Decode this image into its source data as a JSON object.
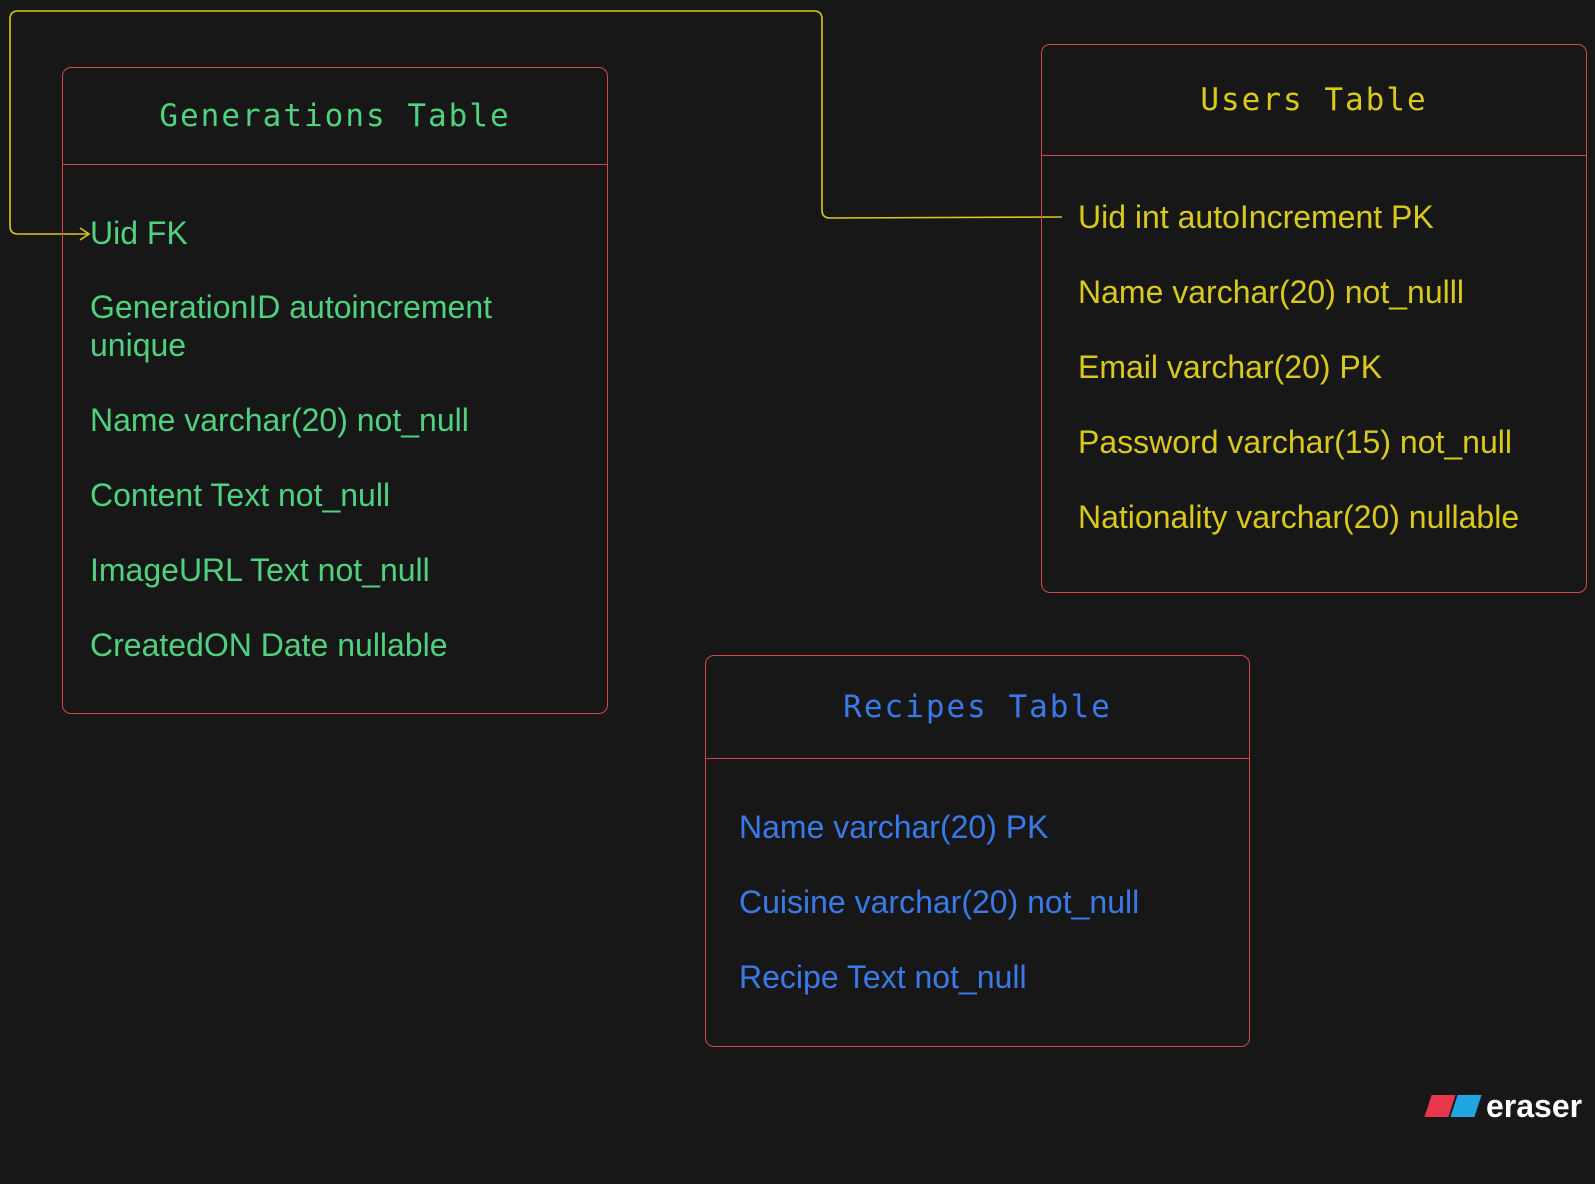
{
  "colors": {
    "background": "#171717",
    "box_border": "#d04848",
    "generations": "#4fd17f",
    "users": "#d8c91c",
    "recipes": "#3a7ae8",
    "connector": "#d8c91c",
    "logo_red": "#e8364a",
    "logo_blue": "#1fa6e0"
  },
  "generations_table": {
    "title": "Generations Table",
    "fields": [
      "Uid FK",
      "GenerationID autoincrement",
      "unique",
      "Name varchar(20) not_null",
      "Content Text not_null",
      "ImageURL Text not_null",
      "CreatedON Date nullable"
    ]
  },
  "users_table": {
    "title": "Users Table",
    "fields": [
      "Uid int autoIncrement PK",
      "Name varchar(20) not_nulll",
      "Email varchar(20) PK",
      "Password varchar(15) not_null",
      "Nationality varchar(20) nullable"
    ]
  },
  "recipes_table": {
    "title": "Recipes Table",
    "fields": [
      "Name varchar(20) PK",
      "Cuisine varchar(20) not_null",
      "Recipe Text not_null"
    ]
  },
  "relationships": [
    {
      "from": "users_table.Uid",
      "to": "generations_table.Uid",
      "arrow": "arrow-head-icon"
    }
  ],
  "brand": {
    "text": "eraser",
    "icon": "eraser-logo-icon"
  }
}
